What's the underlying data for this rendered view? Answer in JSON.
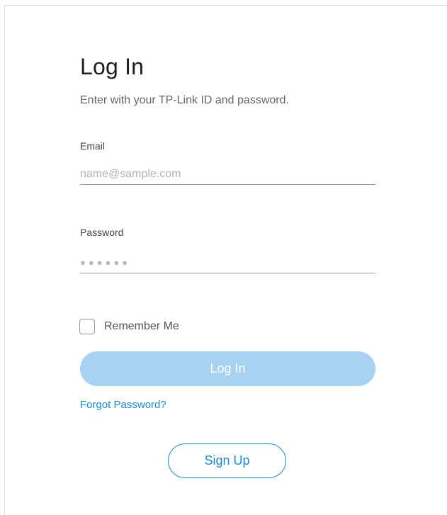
{
  "login": {
    "title": "Log In",
    "subtitle": "Enter with your TP-Link ID and password.",
    "email": {
      "label": "Email",
      "placeholder": "name@sample.com",
      "value": ""
    },
    "password": {
      "label": "Password",
      "placeholder": "●●●●●●",
      "value": ""
    },
    "remember_label": "Remember Me",
    "remember_checked": false,
    "login_button": "Log In",
    "forgot_link": "Forgot Password?",
    "signup_button": "Sign Up"
  },
  "colors": {
    "accent": "#1a8ad4",
    "login_button_disabled": "#a8d2f2"
  }
}
